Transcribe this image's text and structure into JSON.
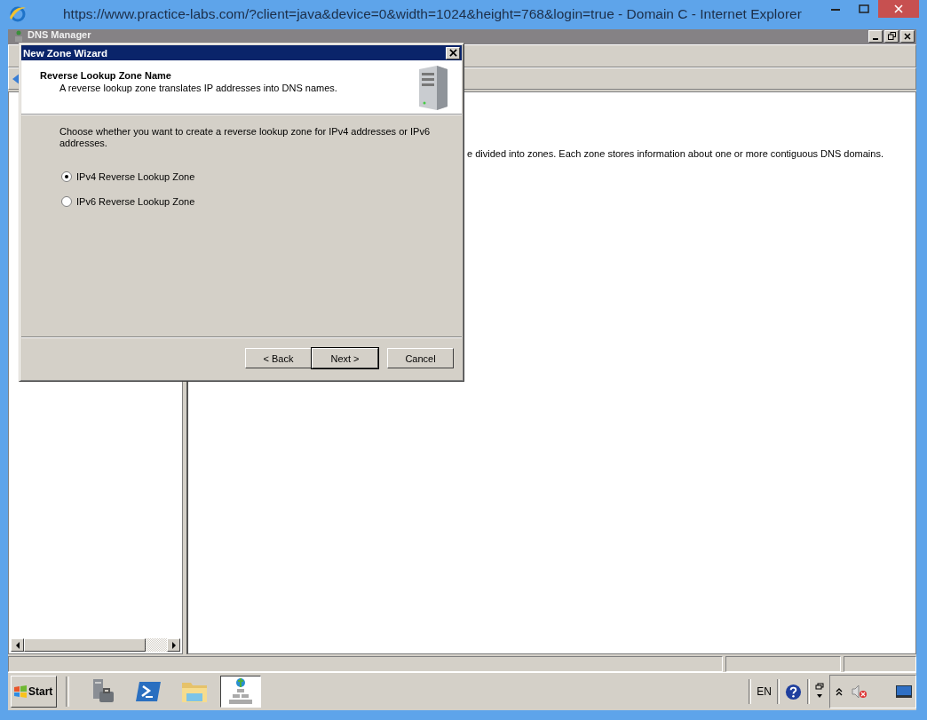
{
  "browser": {
    "title": "https://www.practice-labs.com/?client=java&device=0&width=1024&height=768&login=true - Domain C - Internet Explorer"
  },
  "app": {
    "title": "DNS Manager"
  },
  "content": {
    "description": "e divided into zones. Each zone stores information about one or more contiguous DNS domains."
  },
  "dialog": {
    "title": "New Zone Wizard",
    "heading": "Reverse Lookup Zone Name",
    "subheading": "A reverse lookup zone translates IP addresses into DNS names.",
    "prompt": "Choose whether you want to create a reverse lookup zone for IPv4 addresses or IPv6 addresses.",
    "options": [
      {
        "label": "IPv4 Reverse Lookup Zone",
        "selected": true
      },
      {
        "label": "IPv6 Reverse Lookup Zone",
        "selected": false
      }
    ],
    "buttons": [
      {
        "label": "< Back",
        "default": false
      },
      {
        "label": "Next >",
        "default": true
      },
      {
        "label": "Cancel",
        "default": false
      }
    ]
  },
  "taskbar": {
    "start": "Start",
    "apps": [
      {
        "kind": "server",
        "selected": false
      },
      {
        "kind": "shell",
        "selected": false
      },
      {
        "kind": "folder",
        "selected": false
      },
      {
        "kind": "dns",
        "selected": true
      }
    ],
    "language": "EN"
  }
}
